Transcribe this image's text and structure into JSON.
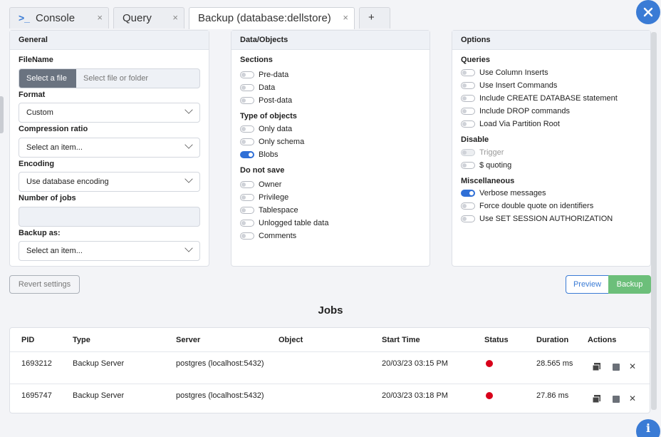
{
  "tabs": [
    {
      "label": "Console",
      "close": "×"
    },
    {
      "label": "Query",
      "close": "×"
    },
    {
      "label": "Backup (database:dellstore)",
      "close": "×"
    },
    {
      "label": "+",
      "close": ""
    }
  ],
  "console_icon": ">_",
  "fab_icons": {
    "top": "tools-icon",
    "bottom": "info-icon"
  },
  "general": {
    "title": "General",
    "filename_label": "FileName",
    "select_file_btn": "Select a file",
    "select_file_placeholder": "Select file or folder",
    "format_label": "Format",
    "format_value": "Custom",
    "compression_label": "Compression ratio",
    "compression_value": "Select an item...",
    "encoding_label": "Encoding",
    "encoding_value": "Use database encoding",
    "jobs_label": "Number of jobs",
    "jobs_value": "",
    "backup_as_label": "Backup as:",
    "backup_as_value": "Select an item..."
  },
  "data_objects": {
    "title": "Data/Objects",
    "sections_title": "Sections",
    "sections": [
      {
        "label": "Pre-data",
        "on": false
      },
      {
        "label": "Data",
        "on": false
      },
      {
        "label": "Post-data",
        "on": false
      }
    ],
    "types_title": "Type of objects",
    "types": [
      {
        "label": "Only data",
        "on": false
      },
      {
        "label": "Only schema",
        "on": false
      },
      {
        "label": "Blobs",
        "on": true
      }
    ],
    "donotsave_title": "Do not save",
    "donotsave": [
      {
        "label": "Owner",
        "on": false
      },
      {
        "label": "Privilege",
        "on": false
      },
      {
        "label": "Tablespace",
        "on": false
      },
      {
        "label": "Unlogged table data",
        "on": false
      },
      {
        "label": "Comments",
        "on": false
      }
    ]
  },
  "options": {
    "title": "Options",
    "queries_title": "Queries",
    "queries": [
      {
        "label": "Use Column Inserts",
        "on": false
      },
      {
        "label": "Use Insert Commands",
        "on": false
      },
      {
        "label": "Include CREATE DATABASE statement",
        "on": false
      },
      {
        "label": "Include DROP commands",
        "on": false
      },
      {
        "label": "Load Via Partition Root",
        "on": false
      }
    ],
    "disable_title": "Disable",
    "disable": [
      {
        "label": "Trigger",
        "on": false,
        "disabled": true
      },
      {
        "label": "$ quoting",
        "on": false,
        "disabled": false
      }
    ],
    "misc_title": "Miscellaneous",
    "misc": [
      {
        "label": "Verbose messages",
        "on": true
      },
      {
        "label": "Force double quote on identifiers",
        "on": false
      },
      {
        "label": "Use SET SESSION AUTHORIZATION",
        "on": false
      }
    ]
  },
  "buttons": {
    "revert": "Revert settings",
    "preview": "Preview",
    "backup": "Backup"
  },
  "jobs": {
    "title": "Jobs",
    "headers": {
      "pid": "PID",
      "type": "Type",
      "server": "Server",
      "object": "Object",
      "start_time": "Start Time",
      "status": "Status",
      "duration": "Duration",
      "actions": "Actions"
    },
    "rows": [
      {
        "pid": "1693212",
        "type": "Backup Server",
        "server": "postgres (localhost:5432)",
        "object": "",
        "start_time": "20/03/23 03:15 PM",
        "status": "error",
        "duration": "28.565 ms"
      },
      {
        "pid": "1695747",
        "type": "Backup Server",
        "server": "postgres (localhost:5432)",
        "object": "",
        "start_time": "20/03/23 03:18 PM",
        "status": "error",
        "duration": "27.86 ms"
      }
    ]
  },
  "colors": {
    "accent": "#2f6fd6",
    "backup_btn": "#6cbf7a",
    "error": "#d8001a"
  }
}
